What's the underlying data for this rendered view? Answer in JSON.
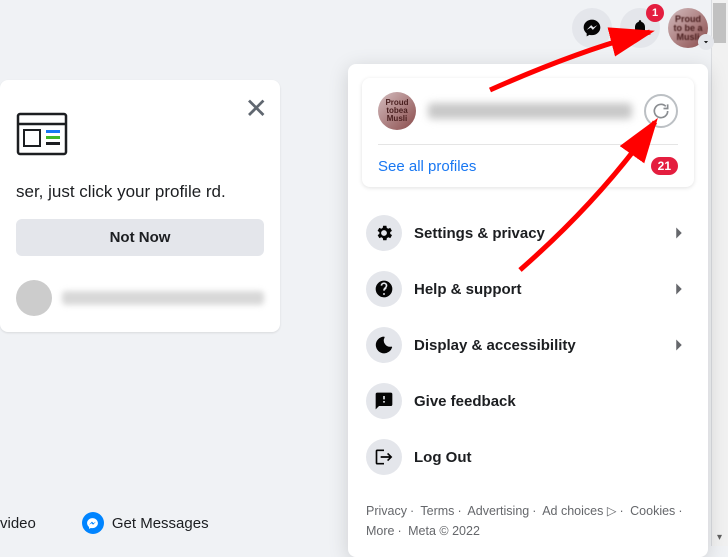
{
  "topbar": {
    "notif_count": "1",
    "avatar_text": "Proud to be a Muslim"
  },
  "left_card": {
    "body_text": "ser, just click your profile rd.",
    "not_now": "Not Now"
  },
  "bottom": {
    "video": "video",
    "get_messages": "Get Messages"
  },
  "dropdown": {
    "see_all": "See all profiles",
    "badge": "21",
    "items": [
      {
        "label": "Settings & privacy",
        "has_chevron": true
      },
      {
        "label": "Help & support",
        "has_chevron": true
      },
      {
        "label": "Display & accessibility",
        "has_chevron": true
      },
      {
        "label": "Give feedback",
        "has_chevron": false
      },
      {
        "label": "Log Out",
        "has_chevron": false
      }
    ],
    "footer": {
      "privacy": "Privacy",
      "terms": "Terms",
      "advertising": "Advertising",
      "ad_choices": "Ad choices",
      "cookies": "Cookies",
      "more": "More",
      "meta": "Meta © 2022"
    }
  }
}
